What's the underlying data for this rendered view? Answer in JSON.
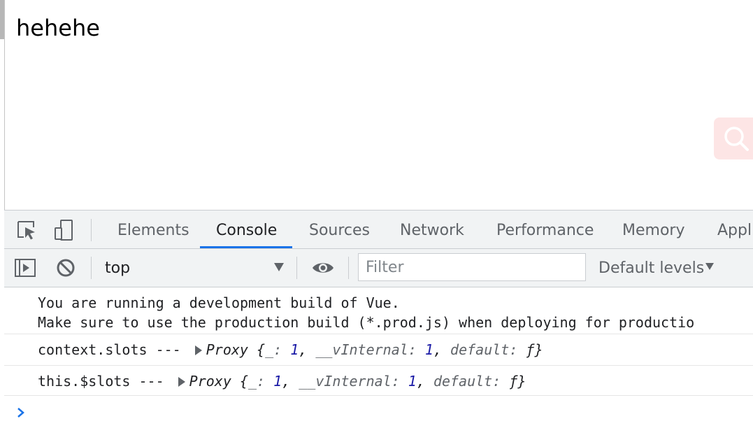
{
  "page": {
    "heading": "hehehe"
  },
  "devtools": {
    "tabs": [
      {
        "label": "Elements"
      },
      {
        "label": "Console"
      },
      {
        "label": "Sources"
      },
      {
        "label": "Network"
      },
      {
        "label": "Performance"
      },
      {
        "label": "Memory"
      },
      {
        "label": "Appli"
      }
    ],
    "active_tab": "Console",
    "toolbar": {
      "context": "top",
      "filter_placeholder": "Filter",
      "levels": "Default levels"
    },
    "console": {
      "vue_warning_line1": "You are running a development build of Vue.",
      "vue_warning_line2": "Make sure to use the production build (*.prod.js) when deploying for productio",
      "log1": {
        "prefix": "context.slots --- ",
        "obj_name": "Proxy",
        "open": "{",
        "k1": "_",
        "v1": "1",
        "k2": "__vInternal",
        "v2": "1",
        "k3": "default",
        "v3": "ƒ",
        "close": "}"
      },
      "log2": {
        "prefix": "this.$slots --- ",
        "obj_name": "Proxy",
        "open": "{",
        "k1": "_",
        "v1": "1",
        "k2": "__vInternal",
        "v2": "1",
        "k3": "default",
        "v3": "ƒ",
        "close": "}"
      }
    }
  },
  "colors": {
    "accent": "#1a73e8",
    "toolbar_bg": "#f1f3f4",
    "number": "#1a1aa6",
    "search_fab_bg": "#fde5e5"
  },
  "icons": {
    "inspect": "inspect-element-icon",
    "device": "device-toolbar-icon",
    "sidebar": "show-sidebar-icon",
    "clear": "clear-console-icon",
    "eye": "live-expression-eye-icon",
    "search": "search-icon",
    "prompt": "chevron-right-icon"
  }
}
